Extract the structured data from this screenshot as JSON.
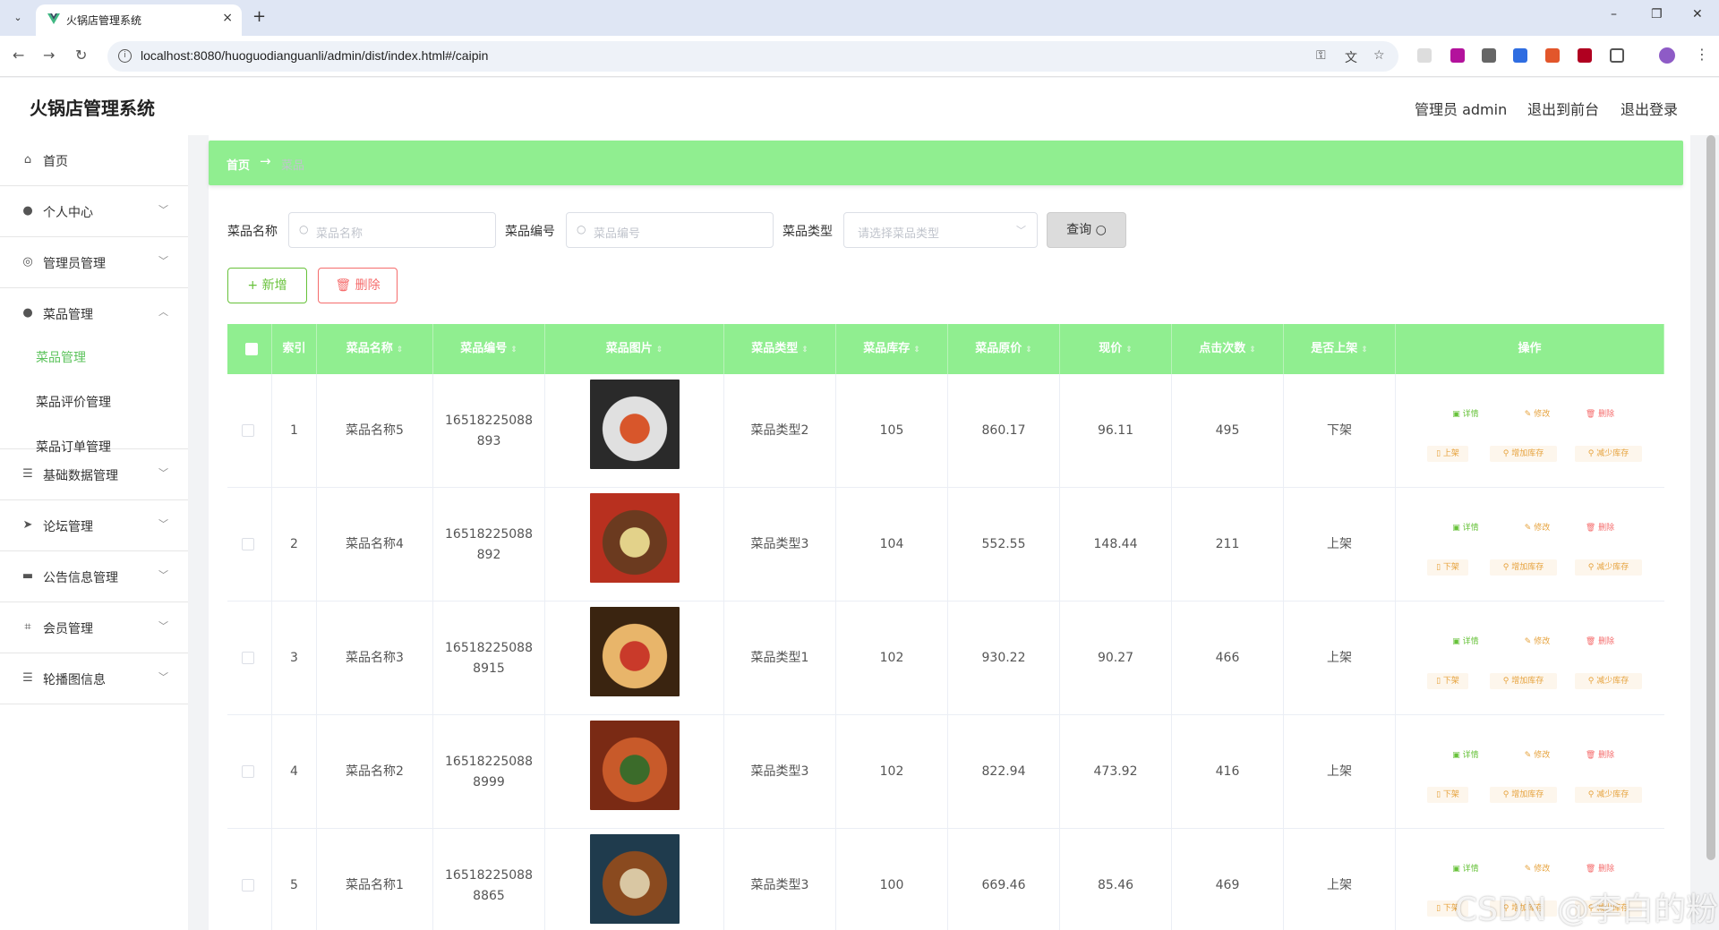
{
  "browser": {
    "tab_title": "火锅店管理系统",
    "url": "localhost:8080/huoguodianguanli/admin/dist/index.html#/caipin",
    "new_tab": "+",
    "close": "×",
    "back": "←",
    "forward": "→",
    "reload": "↻",
    "minimize": "–",
    "restore": "❐",
    "close_window": "✕"
  },
  "header": {
    "title": "火锅店管理系统",
    "admin_label": "管理员 admin",
    "to_front": "退出到前台",
    "logout": "退出登录"
  },
  "sidebar": {
    "items": [
      {
        "label": "首页",
        "icon": "home-icon"
      },
      {
        "label": "个人中心",
        "icon": "user-icon"
      },
      {
        "label": "管理员管理",
        "icon": "compass-icon"
      },
      {
        "label": "菜品管理",
        "icon": "user-icon"
      },
      {
        "label": "基础数据管理",
        "icon": "list-icon"
      },
      {
        "label": "论坛管理",
        "icon": "send-icon"
      },
      {
        "label": "公告信息管理",
        "icon": "briefcase-icon"
      },
      {
        "label": "会员管理",
        "icon": "crop-icon"
      },
      {
        "label": "轮播图信息",
        "icon": "list-icon"
      }
    ],
    "sub_items": [
      "菜品管理",
      "菜品评价管理",
      "菜品订单管理"
    ]
  },
  "breadcrumb": {
    "home": "首页",
    "sep": "→",
    "current": "菜品"
  },
  "filters": {
    "name_label": "菜品名称",
    "name_placeholder": "菜品名称",
    "code_label": "菜品编号",
    "code_placeholder": "菜品编号",
    "type_label": "菜品类型",
    "type_placeholder": "请选择菜品类型",
    "query": "查询"
  },
  "actions": {
    "add": "新增",
    "delete": "删除"
  },
  "table": {
    "headers": [
      "索引",
      "菜品名称",
      "菜品编号",
      "菜品图片",
      "菜品类型",
      "菜品库存",
      "菜品原价",
      "现价",
      "点击次数",
      "是否上架",
      "操作"
    ],
    "op_labels": {
      "detail": "详情",
      "edit": "修改",
      "delete": "删除",
      "add_stock": "增加库存",
      "sub_stock": "减少库存"
    },
    "rows": [
      {
        "index": "1",
        "name": "菜品名称5",
        "code": "16518225088893",
        "type": "菜品类型2",
        "stock": "105",
        "orig_price": "860.17",
        "price": "96.11",
        "clicks": "495",
        "on_shelf": "下架",
        "shelf_action": "上架",
        "img_colors": [
          "#2a2a2a",
          "#e0e0e0",
          "#d8562b"
        ]
      },
      {
        "index": "2",
        "name": "菜品名称4",
        "code": "16518225088892",
        "type": "菜品类型3",
        "stock": "104",
        "orig_price": "552.55",
        "price": "148.44",
        "clicks": "211",
        "on_shelf": "上架",
        "shelf_action": "下架",
        "img_colors": [
          "#b8301f",
          "#6b3a1f",
          "#e3d28a"
        ]
      },
      {
        "index": "3",
        "name": "菜品名称3",
        "code": "165182250888915",
        "type": "菜品类型1",
        "stock": "102",
        "orig_price": "930.22",
        "price": "90.27",
        "clicks": "466",
        "on_shelf": "上架",
        "shelf_action": "下架",
        "img_colors": [
          "#3a2410",
          "#e8b56a",
          "#c93a2a"
        ]
      },
      {
        "index": "4",
        "name": "菜品名称2",
        "code": "165182250888999",
        "type": "菜品类型3",
        "stock": "102",
        "orig_price": "822.94",
        "price": "473.92",
        "clicks": "416",
        "on_shelf": "上架",
        "shelf_action": "下架",
        "img_colors": [
          "#7a2a14",
          "#c85a2a",
          "#3b6b2a"
        ]
      },
      {
        "index": "5",
        "name": "菜品名称1",
        "code": "165182250888865",
        "type": "菜品类型3",
        "stock": "100",
        "orig_price": "669.46",
        "price": "85.46",
        "clicks": "469",
        "on_shelf": "上架",
        "shelf_action": "下架",
        "img_colors": [
          "#1f3b4d",
          "#8a4a1f",
          "#d9c7a3"
        ]
      }
    ]
  },
  "watermark": "CSDN @李白的粉",
  "colors": {
    "accent": "#90ee90",
    "active": "#5cc35c",
    "success": "#67c23a",
    "danger": "#f56c6c",
    "warning": "#e6a23c"
  }
}
